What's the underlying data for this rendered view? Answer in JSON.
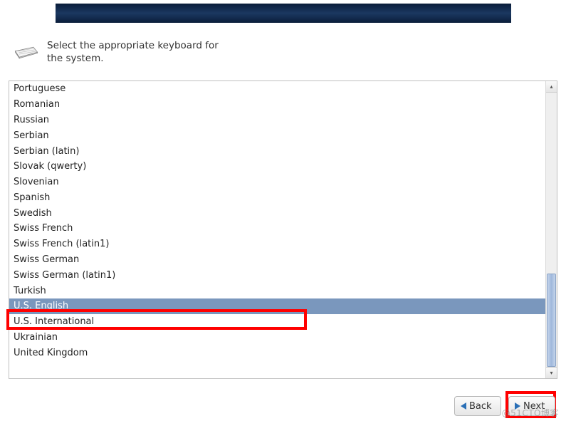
{
  "header": {
    "instruction": "Select the appropriate keyboard for the system."
  },
  "keyboards": [
    {
      "label": "Portuguese",
      "selected": false
    },
    {
      "label": "Romanian",
      "selected": false
    },
    {
      "label": "Russian",
      "selected": false
    },
    {
      "label": "Serbian",
      "selected": false
    },
    {
      "label": "Serbian (latin)",
      "selected": false
    },
    {
      "label": "Slovak (qwerty)",
      "selected": false
    },
    {
      "label": "Slovenian",
      "selected": false
    },
    {
      "label": "Spanish",
      "selected": false
    },
    {
      "label": "Swedish",
      "selected": false
    },
    {
      "label": "Swiss French",
      "selected": false
    },
    {
      "label": "Swiss French (latin1)",
      "selected": false
    },
    {
      "label": "Swiss German",
      "selected": false
    },
    {
      "label": "Swiss German (latin1)",
      "selected": false
    },
    {
      "label": "Turkish",
      "selected": false
    },
    {
      "label": "U.S. English",
      "selected": true
    },
    {
      "label": "U.S. International",
      "selected": false
    },
    {
      "label": "Ukrainian",
      "selected": false
    },
    {
      "label": "United Kingdom",
      "selected": false
    }
  ],
  "scrollbar": {
    "thumb_top_pct": 66,
    "thumb_height_pct": 34
  },
  "buttons": {
    "back": "Back",
    "next": "Next"
  },
  "watermark": "@51CTO博客",
  "colors": {
    "banner_dark": "#0a1d3a",
    "banner_light": "#1b3861",
    "selection": "#7a97bd",
    "highlight_red": "#ff0000",
    "arrow_blue": "#2a6fb6"
  }
}
